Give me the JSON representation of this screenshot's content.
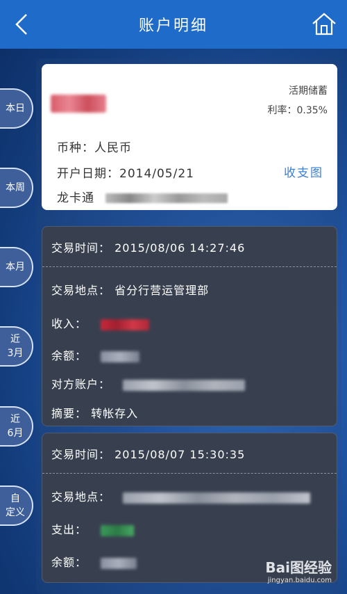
{
  "header": {
    "title": "账户明细"
  },
  "side_tabs": [
    "本日",
    "本周",
    "本月",
    "近\n3月",
    "近\n6月",
    "自\n定义"
  ],
  "account": {
    "type": "活期储蓄",
    "rate": "利率：0.35%",
    "currency": "币种：人民币",
    "open_date": "开户日期：2014/05/21",
    "card_label": "龙卡通",
    "chart_link": "收支图"
  },
  "transactions": [
    {
      "time": "交易时间：  2015/08/06  14:27:46",
      "place": "交易地点：  省分行营运管理部",
      "amount_label": "收入：",
      "balance_label": "余额：",
      "counterparty_label": "对方账户：",
      "summary": "摘要：  转帐存入"
    },
    {
      "time": "交易时间：  2015/08/07  15:30:35",
      "place_label": "交易地点：",
      "amount_label": "支出：",
      "balance_label": "余额："
    }
  ],
  "watermark": {
    "logo": "Bai图经验",
    "url": "jingyan.baidu.com"
  },
  "colors": {
    "topbar": "#1f6bc9",
    "income": "#c8283a",
    "expense": "#3a9a5a",
    "link": "#3a80d0"
  }
}
